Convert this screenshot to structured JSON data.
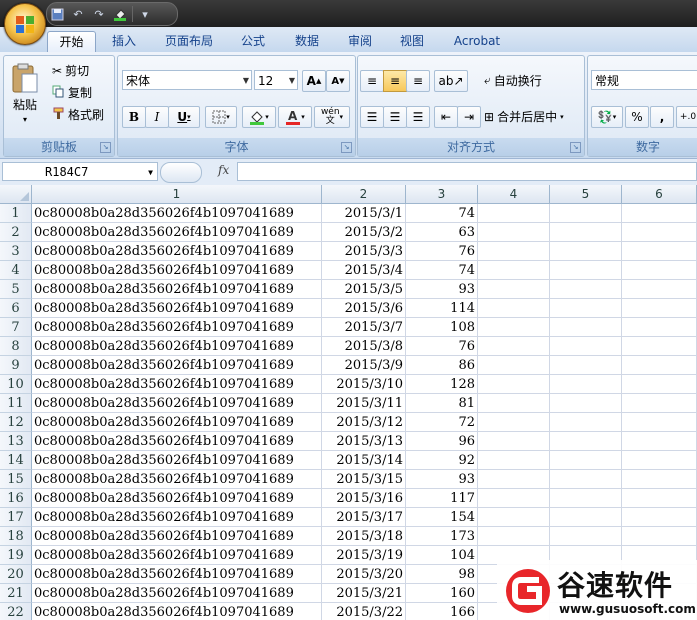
{
  "quick_access": {
    "icons": [
      "save-icon",
      "undo-icon",
      "redo-icon",
      "fill-color-icon",
      "customize-icon"
    ]
  },
  "tabs": [
    {
      "label": "开始",
      "active": true
    },
    {
      "label": "插入"
    },
    {
      "label": "页面布局"
    },
    {
      "label": "公式"
    },
    {
      "label": "数据"
    },
    {
      "label": "审阅"
    },
    {
      "label": "视图"
    },
    {
      "label": "Acrobat"
    }
  ],
  "ribbon": {
    "clipboard": {
      "label": "剪贴板",
      "paste": "粘贴",
      "cut": "剪切",
      "copy": "复制",
      "format_painter": "格式刷"
    },
    "font": {
      "label": "字体",
      "font_name": "宋体",
      "font_size": "12",
      "grow": "A",
      "shrink": "A",
      "bold": "B",
      "italic": "I",
      "underline": "U",
      "wen": "wén"
    },
    "alignment": {
      "label": "对齐方式",
      "wrap_text": "自动换行",
      "merge_center": "合并后居中"
    },
    "number": {
      "label": "数字",
      "format": "常规",
      "percent": "%",
      "comma": ","
    }
  },
  "formula_bar": {
    "name_box": "R184C7",
    "fx": "fx",
    "content": ""
  },
  "columns": [
    "1",
    "2",
    "3",
    "4",
    "5",
    "6"
  ],
  "rows": [
    {
      "n": "1",
      "id": "0c80008b0a28d356026f4b1097041689",
      "date": "2015/3/1",
      "value": "74"
    },
    {
      "n": "2",
      "id": "0c80008b0a28d356026f4b1097041689",
      "date": "2015/3/2",
      "value": "63"
    },
    {
      "n": "3",
      "id": "0c80008b0a28d356026f4b1097041689",
      "date": "2015/3/3",
      "value": "76"
    },
    {
      "n": "4",
      "id": "0c80008b0a28d356026f4b1097041689",
      "date": "2015/3/4",
      "value": "74"
    },
    {
      "n": "5",
      "id": "0c80008b0a28d356026f4b1097041689",
      "date": "2015/3/5",
      "value": "93"
    },
    {
      "n": "6",
      "id": "0c80008b0a28d356026f4b1097041689",
      "date": "2015/3/6",
      "value": "114"
    },
    {
      "n": "7",
      "id": "0c80008b0a28d356026f4b1097041689",
      "date": "2015/3/7",
      "value": "108"
    },
    {
      "n": "8",
      "id": "0c80008b0a28d356026f4b1097041689",
      "date": "2015/3/8",
      "value": "76"
    },
    {
      "n": "9",
      "id": "0c80008b0a28d356026f4b1097041689",
      "date": "2015/3/9",
      "value": "86"
    },
    {
      "n": "10",
      "id": "0c80008b0a28d356026f4b1097041689",
      "date": "2015/3/10",
      "value": "128"
    },
    {
      "n": "11",
      "id": "0c80008b0a28d356026f4b1097041689",
      "date": "2015/3/11",
      "value": "81"
    },
    {
      "n": "12",
      "id": "0c80008b0a28d356026f4b1097041689",
      "date": "2015/3/12",
      "value": "72"
    },
    {
      "n": "13",
      "id": "0c80008b0a28d356026f4b1097041689",
      "date": "2015/3/13",
      "value": "96"
    },
    {
      "n": "14",
      "id": "0c80008b0a28d356026f4b1097041689",
      "date": "2015/3/14",
      "value": "92"
    },
    {
      "n": "15",
      "id": "0c80008b0a28d356026f4b1097041689",
      "date": "2015/3/15",
      "value": "93"
    },
    {
      "n": "16",
      "id": "0c80008b0a28d356026f4b1097041689",
      "date": "2015/3/16",
      "value": "117"
    },
    {
      "n": "17",
      "id": "0c80008b0a28d356026f4b1097041689",
      "date": "2015/3/17",
      "value": "154"
    },
    {
      "n": "18",
      "id": "0c80008b0a28d356026f4b1097041689",
      "date": "2015/3/18",
      "value": "173"
    },
    {
      "n": "19",
      "id": "0c80008b0a28d356026f4b1097041689",
      "date": "2015/3/19",
      "value": "104"
    },
    {
      "n": "20",
      "id": "0c80008b0a28d356026f4b1097041689",
      "date": "2015/3/20",
      "value": "98"
    },
    {
      "n": "21",
      "id": "0c80008b0a28d356026f4b1097041689",
      "date": "2015/3/21",
      "value": "160"
    },
    {
      "n": "22",
      "id": "0c80008b0a28d356026f4b1097041689",
      "date": "2015/3/22",
      "value": "166"
    }
  ],
  "watermark": {
    "name": "谷速软件",
    "url": "www.gusuosoft.com",
    "brand_color": "#e8262a"
  },
  "colors": {
    "tab_text": "#15428b",
    "ribbon_bg": "#dbe6f4",
    "grid_line": "#d0d7e5"
  }
}
